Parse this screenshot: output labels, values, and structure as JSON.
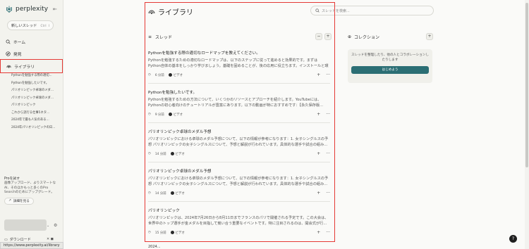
{
  "app": {
    "logo_text": "perplexity"
  },
  "sidebar": {
    "new_thread_label": "新しいスレッド",
    "new_thread_shortcut": "Ctrl",
    "new_thread_shortcut_key": "I",
    "nav": [
      {
        "label": "ホーム",
        "icon": "search-icon"
      },
      {
        "label": "発見",
        "icon": "compass-icon"
      },
      {
        "label": "ライブラリ",
        "icon": "library-icon"
      }
    ],
    "library_items": [
      "Pythonを勉強する際の適切...",
      "Pythonを勉強したいです。",
      "パリオリンピック卓球のメダル...",
      "パリオリンピック卓球のメダル...",
      "パリオリンピック",
      "これから流行る仕事5ネタ...",
      "2024年で最も人気のある...",
      "2024年パリオリンピックの日..."
    ],
    "pro": {
      "title": "Proを試す",
      "description": "画像アップロード、よりスマートなAI、そのほかもっと多くのPro Searchのためにアップグレード。",
      "link_label": "詳細を見る"
    },
    "download_label": "ダウンロード",
    "status_url": "https://www.perplexity.ai/library"
  },
  "main": {
    "title": "ライブラリ",
    "search_placeholder": "スレッドを検索...",
    "threads_heading": "スレッド",
    "collections_heading": "コレクション",
    "collections_empty_text": "スレッドを整理したり、他の人とコラボレーションしたりします",
    "collections_button": "はじめよう",
    "threads": [
      {
        "title": "Pythonを勉強する際の適切なロードマップを教えてください。",
        "snippet": "Pythonを勉強するための適切なロードマップは、以下のステップに従って進めると効果的です。まずはPython自体の基本をしっかり学びましょう。基礎を固めることが、後の応用に役立ちます。インストールと環境設定...",
        "time": "6 分前",
        "source": "ビデオ"
      },
      {
        "title": "Pythonを勉強したいです。",
        "snippet": "Pythonを勉強するための方法について、いくつかのリソースとアプローチを紹介します。YouTubeには、Pythonの初心者向けのチュートリアルが豊富にあります。以下の動画が特におすすめです：【永久保存版...",
        "time": "9 分前",
        "source": "ビデオ"
      },
      {
        "title": "パリオリンピック卓球のメダル予想",
        "snippet": "パリオリンピックにおける卓球のメダル予想について、以下の情報が参考になります：1. 女子シングルスの予想 パリオリンピックの女子シングルスについて、予想と解説が行われています。具体的な選手や試合の組み...",
        "time": "14 分前",
        "source": "ビデオ"
      },
      {
        "title": "パリオリンピック卓球のメダル予想",
        "snippet": "パリオリンピックにおける卓球のメダル予想について、以下の情報が参考になります：1. 女子シングルスの予想 パリオリンピックの女子シングルスについて、予想と解説が行われています。具体的な選手や試合の組み...",
        "time": "14 分前",
        "source": "ビデオ"
      },
      {
        "title": "パリオリンピック",
        "snippet": "パリオリンピックは、2024年7月26日から8月11日までフランスのパリで開催される予定です。この大会は、世界中のトップ選手が金メダルを目指して競い合う重要なイベントです。特に注目されるのは、開会式が行...",
        "time": "15 分前",
        "source": "ビデオ"
      }
    ],
    "last_peek": "2024..."
  }
}
